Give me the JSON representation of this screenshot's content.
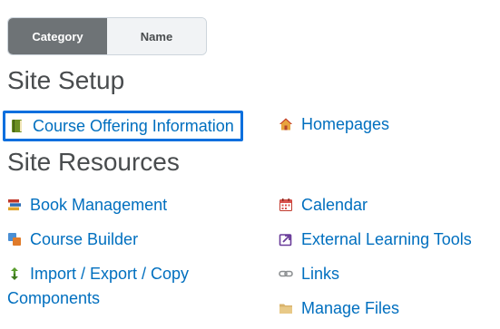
{
  "toggle": {
    "options": [
      {
        "label": "Category",
        "active": true
      },
      {
        "label": "Name",
        "active": false
      }
    ]
  },
  "sections": {
    "setup": {
      "title": "Site Setup",
      "items": [
        {
          "label": "Course Offering Information",
          "icon": "book-icon",
          "focused": true
        },
        {
          "label": "Homepages",
          "icon": "home-icon"
        }
      ]
    },
    "resources": {
      "title": "Site Resources",
      "items": [
        {
          "label": "Book Management",
          "icon": "books-stack-icon"
        },
        {
          "label": "Calendar",
          "icon": "calendar-icon"
        },
        {
          "label": "Course Builder",
          "icon": "course-builder-icon"
        },
        {
          "label": "External Learning Tools",
          "icon": "external-tool-icon"
        },
        {
          "label": "Import / Export / Copy Components",
          "icon": "import-export-icon"
        },
        {
          "label": "Links",
          "icon": "link-icon"
        },
        {
          "label": "Manage Files",
          "icon": "folder-icon"
        }
      ]
    }
  },
  "colors": {
    "link": "#006fbf",
    "heading": "#494c4e",
    "toggle_active_bg": "#6e7376",
    "toggle_inactive_bg": "#f1f3f5",
    "focus_ring": "#0b6fde"
  }
}
